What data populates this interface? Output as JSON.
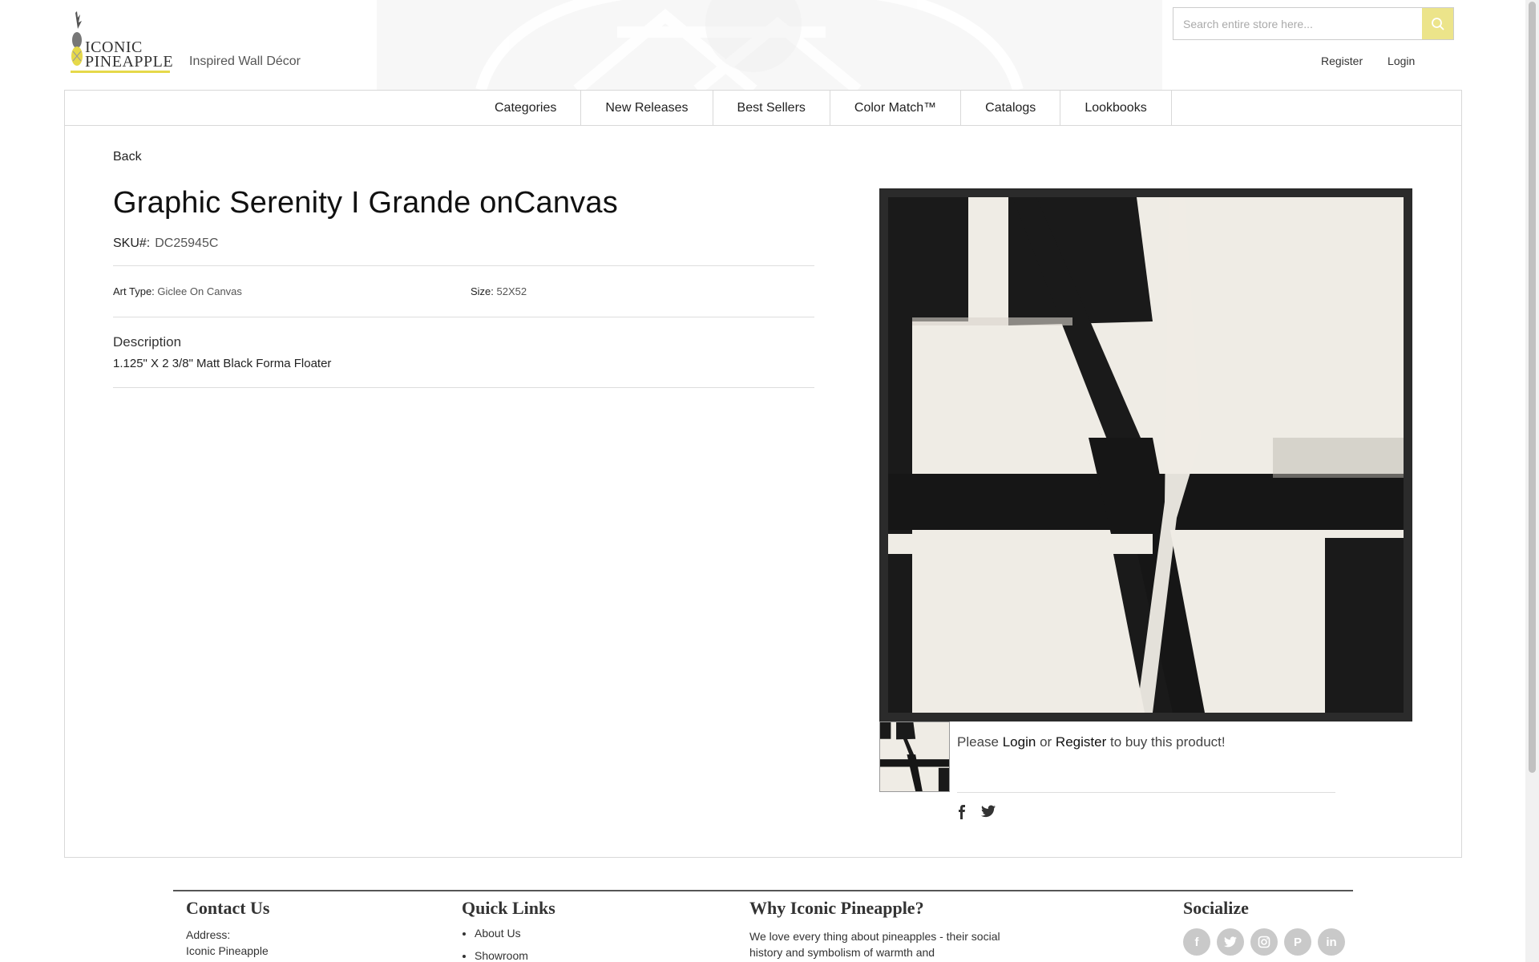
{
  "header": {
    "logo_line1": "ICONIC",
    "logo_line2": "PINEAPPLE",
    "tagline": "Inspired Wall Décor",
    "search_placeholder": "Search entire store here...",
    "register_label": "Register",
    "login_label": "Login"
  },
  "nav": {
    "items": [
      "Categories",
      "New Releases",
      "Best Sellers",
      "Color Match™",
      "Catalogs",
      "Lookbooks"
    ]
  },
  "product": {
    "back_label": "Back",
    "title": "Graphic Serenity I Grande onCanvas",
    "sku_label": "SKU#:",
    "sku_value": "DC25945C",
    "art_type_label": "Art Type:",
    "art_type_value": "Giclee On Canvas",
    "size_label": "Size:",
    "size_value": "52X52",
    "description_heading": "Description",
    "description_text": "1.125\" X 2 3/8\" Matt Black Forma Floater",
    "buy_prefix": "Please",
    "buy_login": "Login",
    "buy_or": "or",
    "buy_register": "Register",
    "buy_suffix": "to buy this product!"
  },
  "footer": {
    "contact_heading": "Contact Us",
    "address_label": "Address:",
    "address_line1": "Iconic Pineapple",
    "quicklinks_heading": "Quick Links",
    "quicklinks": [
      "About Us",
      "Showroom"
    ],
    "why_heading": "Why Iconic Pineapple?",
    "why_text": "We love every thing about pineapples - their social history and symbolism of warmth and",
    "socialize_heading": "Socialize"
  },
  "colors": {
    "accent": "#ece48a",
    "logo_bar": "#e6d94a"
  }
}
